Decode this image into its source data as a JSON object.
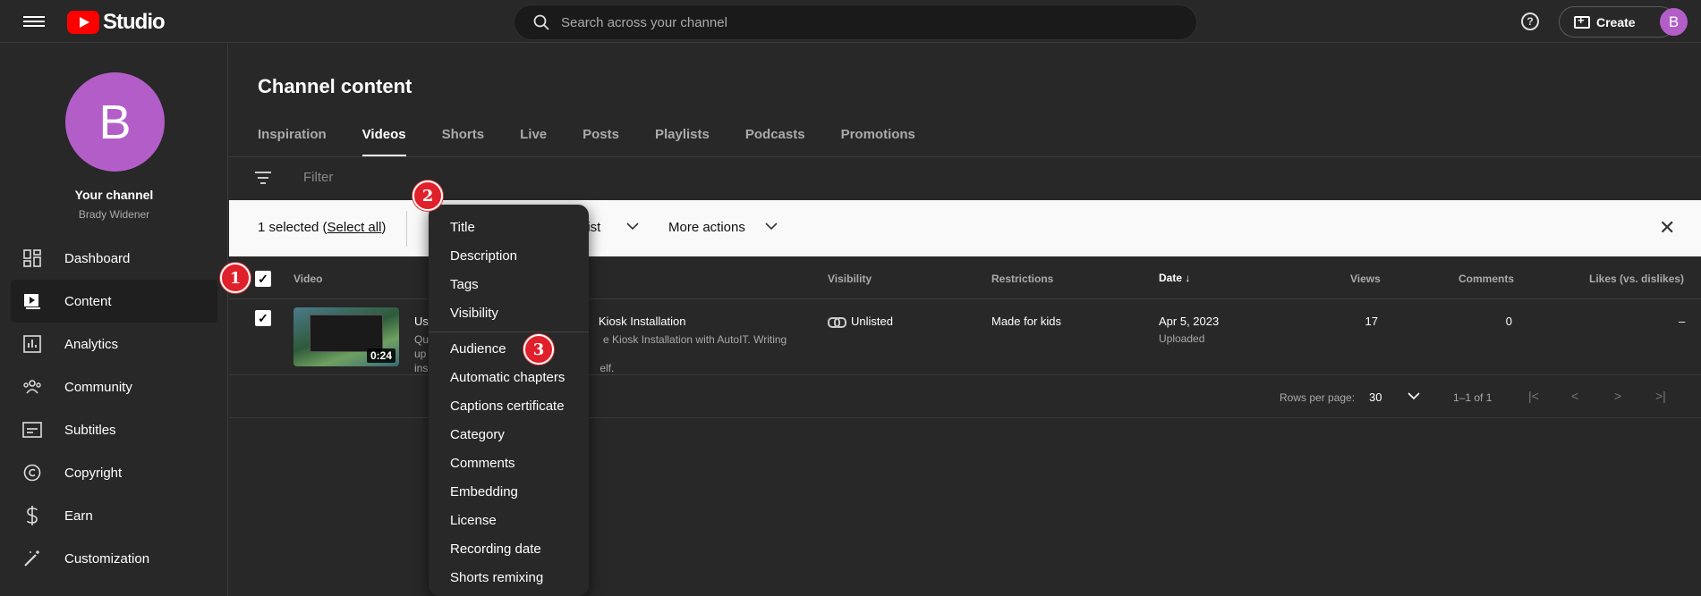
{
  "app": {
    "logo_text": "Studio"
  },
  "search": {
    "placeholder": "Search across your channel"
  },
  "header": {
    "help_icon": "?",
    "create_label": "Create",
    "avatar_letter": "B"
  },
  "sidebar": {
    "avatar_letter": "B",
    "channel_title": "Your channel",
    "channel_name": "Brady Widener",
    "items": [
      {
        "label": "Dashboard",
        "icon": "dashboard-icon"
      },
      {
        "label": "Content",
        "icon": "content-icon",
        "active": true
      },
      {
        "label": "Analytics",
        "icon": "analytics-icon"
      },
      {
        "label": "Community",
        "icon": "community-icon"
      },
      {
        "label": "Subtitles",
        "icon": "subtitles-icon"
      },
      {
        "label": "Copyright",
        "icon": "copyright-icon"
      },
      {
        "label": "Earn",
        "icon": "earn-icon"
      },
      {
        "label": "Customization",
        "icon": "customization-icon"
      }
    ]
  },
  "page": {
    "title": "Channel content"
  },
  "tabs": [
    "Inspiration",
    "Videos",
    "Shorts",
    "Live",
    "Posts",
    "Playlists",
    "Podcasts",
    "Promotions"
  ],
  "filter": {
    "placeholder": "Filter"
  },
  "selection_bar": {
    "selected_prefix": "1 selected (",
    "select_all": "Select all",
    "selected_suffix": ")",
    "playlist_label": "list",
    "more_actions": "More actions",
    "close": "✕"
  },
  "table": {
    "headers": {
      "video": "Video",
      "visibility": "Visibility",
      "restrictions": "Restrictions",
      "date": "Date",
      "views": "Views",
      "comments": "Comments",
      "likes": "Likes (vs. dislikes)"
    },
    "row": {
      "duration": "0:24",
      "title_start": "Us",
      "title_end": "Kiosk Installation",
      "desc_line1_start": "Qu",
      "desc_line1_end": "e Kiosk Installation with AutoIT. Writing up",
      "desc_line2_start": "ins",
      "desc_line2_end": "elf.",
      "visibility": "Unlisted",
      "restriction": "Made for kids",
      "date": "Apr 5, 2023",
      "date_sub": "Uploaded",
      "views": "17",
      "comments": "0",
      "likes": "–"
    }
  },
  "pager": {
    "rows_per_page_label": "Rows per page:",
    "rows_per_page_value": "30",
    "range": "1–1 of 1"
  },
  "menu": {
    "items": [
      "Title",
      "Description",
      "Tags",
      "Visibility",
      "Audience",
      "Automatic chapters",
      "Captions certificate",
      "Category",
      "Comments",
      "Embedding",
      "License",
      "Recording date",
      "Shorts remixing"
    ]
  },
  "markers": [
    "1",
    "2",
    "3"
  ],
  "colors": {
    "accent_red": "#e0202a",
    "avatar_purple": "#b35ec8",
    "youtube_red": "#ff0000"
  }
}
